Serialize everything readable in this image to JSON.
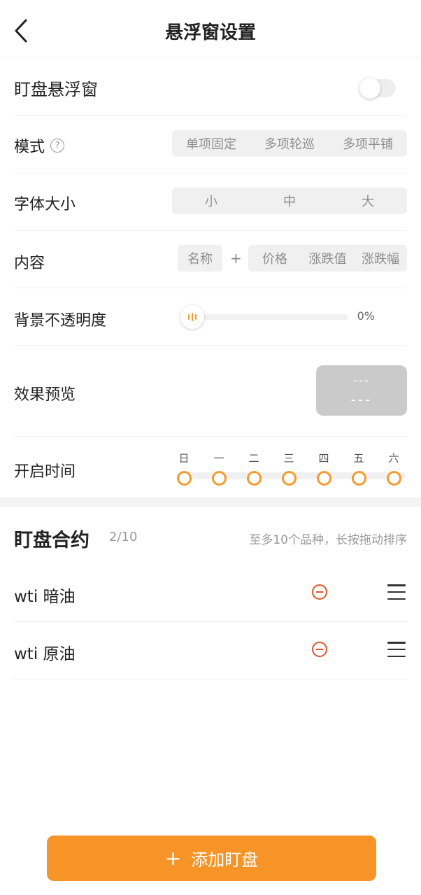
{
  "colors": {
    "accent": "#f79428",
    "remove": "#e0542c",
    "chip_bg": "#f0f0f0"
  },
  "header": {
    "title": "悬浮窗设置",
    "back_icon": "chevron-left-icon"
  },
  "floating": {
    "label": "盯盘悬浮窗",
    "enabled": false
  },
  "mode": {
    "label": "模式",
    "help_icon": "question-circle-icon",
    "options": [
      "单项固定",
      "多项轮巡",
      "多项平铺"
    ]
  },
  "font_size": {
    "label": "字体大小",
    "options": [
      "小",
      "中",
      "大"
    ]
  },
  "content": {
    "label": "内容",
    "name_chip": "名称",
    "plus": "+",
    "options": [
      "价格",
      "涨跌值",
      "涨跌幅"
    ]
  },
  "opacity": {
    "label": "背景不透明度",
    "value": "0%",
    "level": 0
  },
  "preview": {
    "label": "效果预览",
    "line1": "---",
    "line2": "---"
  },
  "schedule": {
    "label": "开启时间",
    "days": [
      "日",
      "一",
      "二",
      "三",
      "四",
      "五",
      "六"
    ]
  },
  "contracts": {
    "title": "盯盘合约",
    "count": "2/10",
    "hint": "至多10个品种，长按拖动排序",
    "items": [
      {
        "name": "wti 暗油"
      },
      {
        "name": "wti 原油"
      }
    ]
  },
  "add_button": {
    "plus": "+",
    "label": "添加盯盘"
  }
}
